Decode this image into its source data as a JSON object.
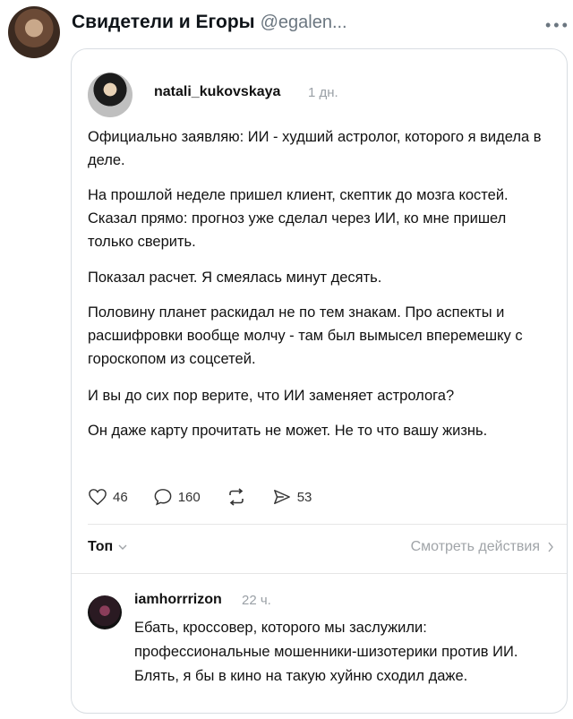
{
  "header": {
    "display_name": "Свидетели и Егоры",
    "handle": "@egalen...",
    "more_icon": "more-dots-icon"
  },
  "post": {
    "username": "natali_kukovskaya",
    "time": "1 дн.",
    "paragraphs": [
      "Официально заявляю: ИИ - худший астролог, которого я видела в деле.",
      "На прошлой неделе пришел клиент, скептик до мозга костей. Сказал прямо: прогноз уже сделал через ИИ, ко мне пришел только сверить.",
      "Показал расчет. Я смеялась минут десять.",
      "Половину планет раскидал не по тем знакам. Про аспекты и расшифровки вообще молчу - там был вымысел вперемешку с гороскопом из соцсетей.",
      "И вы до сих пор верите, что ИИ заменяет астролога?",
      "Он даже карту прочитать не может. Не то что вашу жизнь."
    ],
    "likes": "46",
    "comments": "160",
    "reposts_icon": "repost-icon",
    "shares": "53"
  },
  "sort": {
    "label": "Топ",
    "view_actions": "Смотреть действия"
  },
  "reply": {
    "username": "iamhorrrizon",
    "time": "22 ч.",
    "text": "Ебать, кроссовер, которого мы заслужили: профессиональные мошенники-шизотерики против ИИ. Блять, я бы в кино на такую хуйню сходил даже."
  }
}
